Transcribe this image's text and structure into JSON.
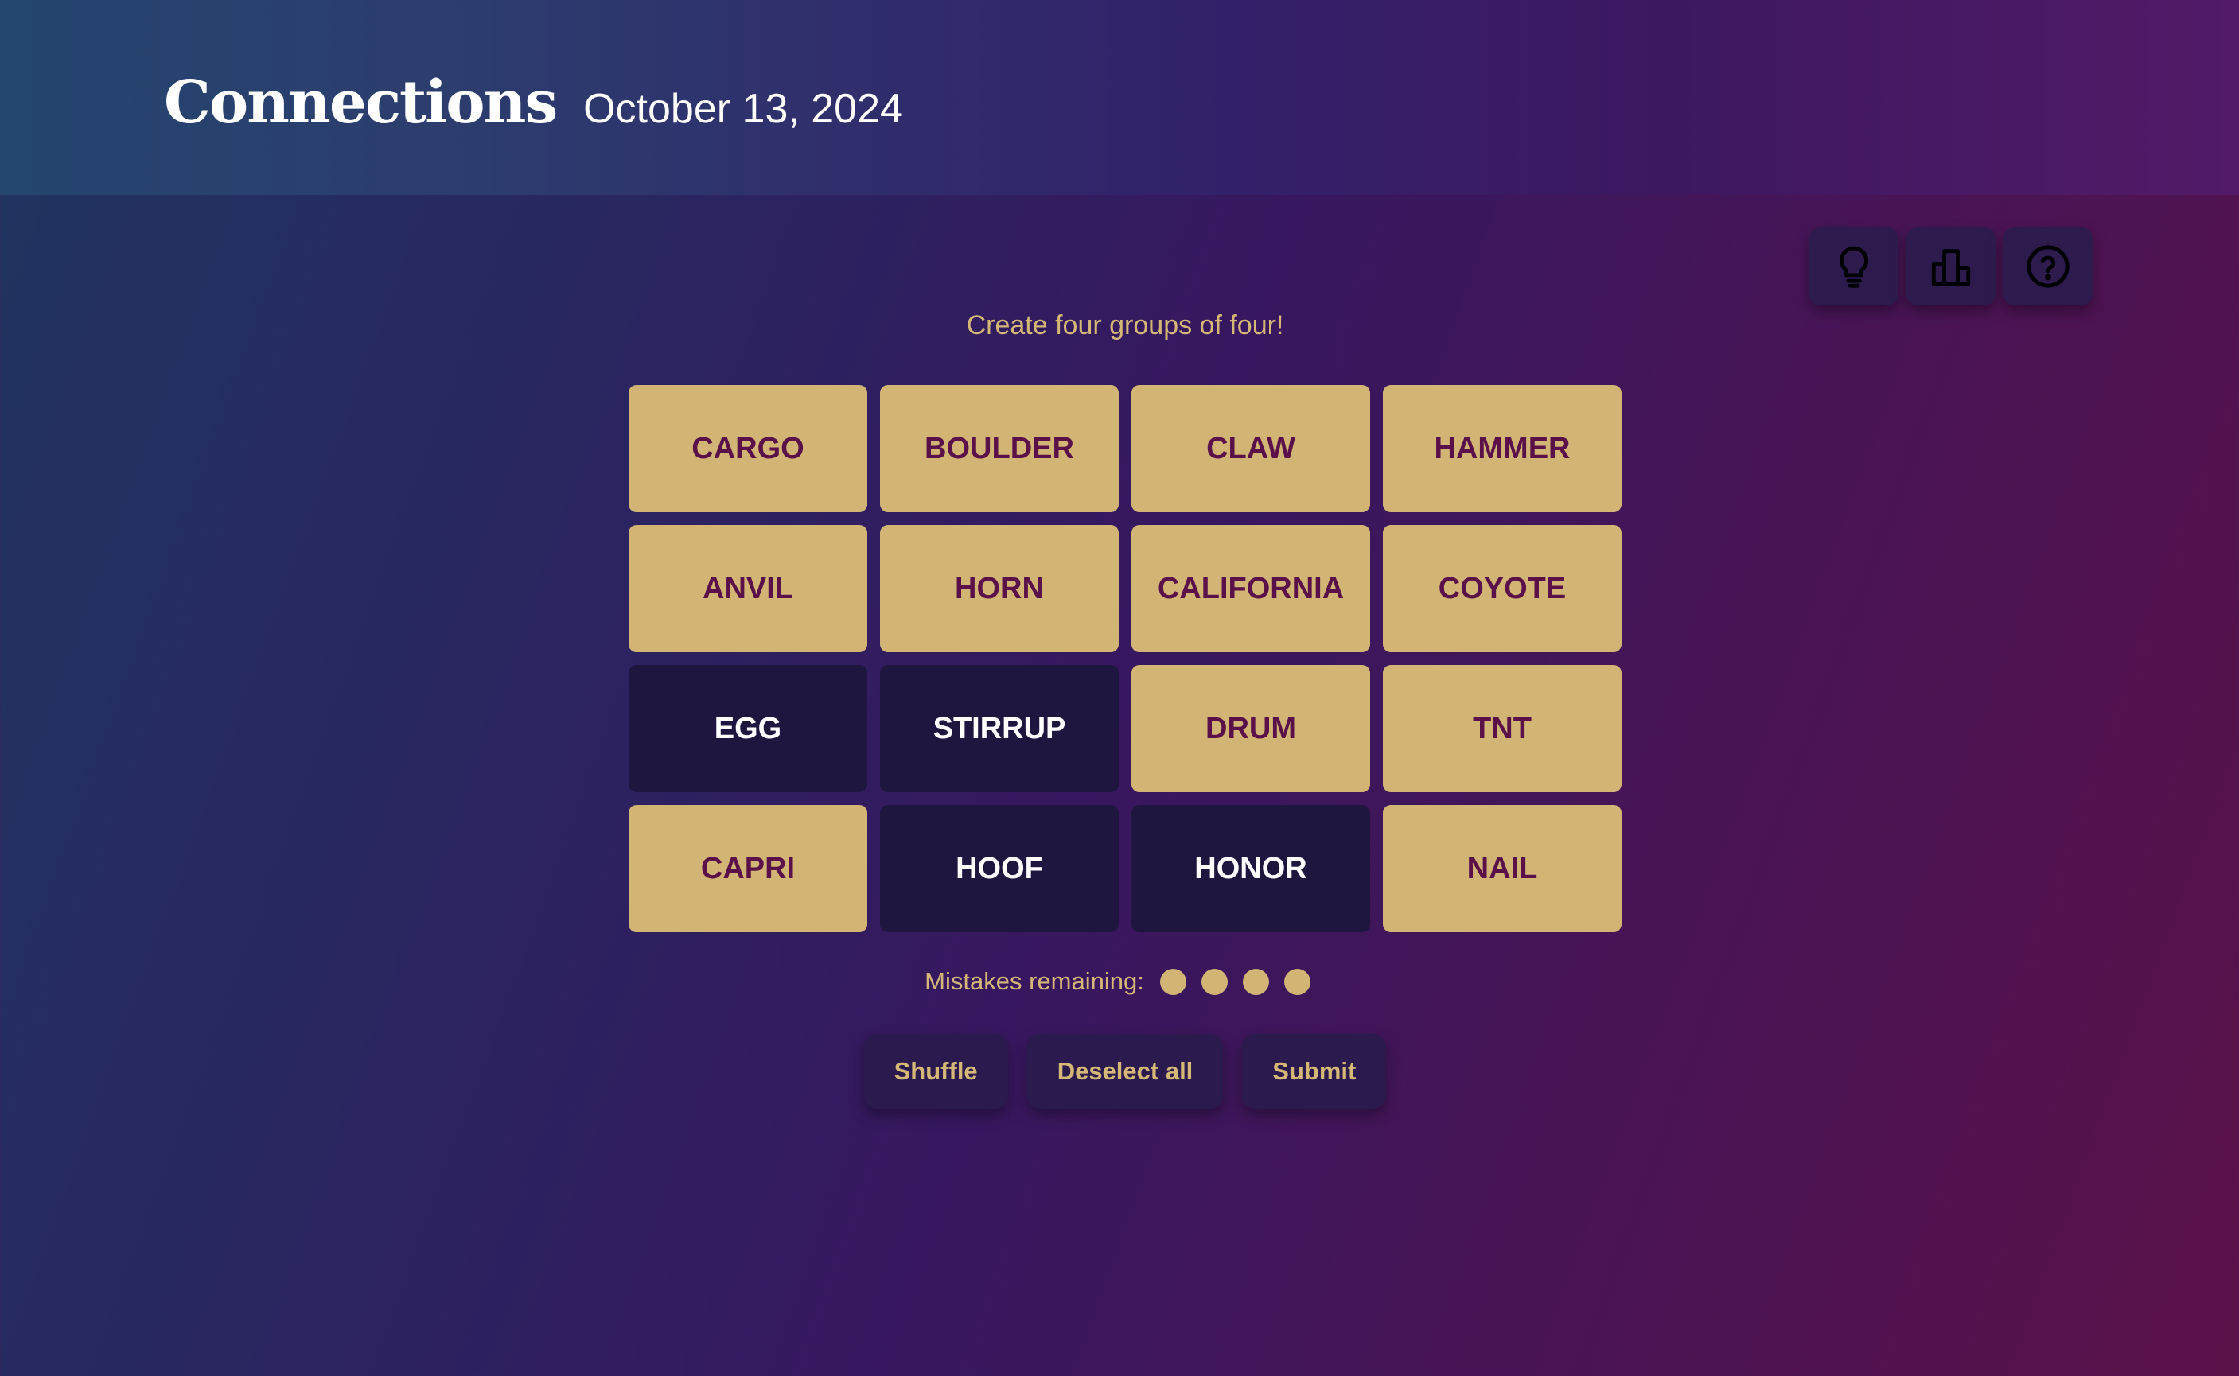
{
  "header": {
    "title": "Connections",
    "date": "October 13, 2024"
  },
  "toolbar": {
    "icons": [
      "lightbulb-icon",
      "leaderboard-icon",
      "help-icon"
    ]
  },
  "prompt": "Create four groups of four!",
  "tiles": [
    {
      "label": "CARGO",
      "selected": false
    },
    {
      "label": "BOULDER",
      "selected": false
    },
    {
      "label": "CLAW",
      "selected": false
    },
    {
      "label": "HAMMER",
      "selected": false
    },
    {
      "label": "ANVIL",
      "selected": false
    },
    {
      "label": "HORN",
      "selected": false
    },
    {
      "label": "CALIFORNIA",
      "selected": false
    },
    {
      "label": "COYOTE",
      "selected": false
    },
    {
      "label": "EGG",
      "selected": true
    },
    {
      "label": "STIRRUP",
      "selected": true
    },
    {
      "label": "DRUM",
      "selected": false
    },
    {
      "label": "TNT",
      "selected": false
    },
    {
      "label": "CAPRI",
      "selected": false
    },
    {
      "label": "HOOF",
      "selected": true
    },
    {
      "label": "HONOR",
      "selected": true
    },
    {
      "label": "NAIL",
      "selected": false
    }
  ],
  "mistakes": {
    "label": "Mistakes remaining:",
    "remaining": 4
  },
  "actions": {
    "shuffle": "Shuffle",
    "deselect_all": "Deselect all",
    "submit": "Submit"
  },
  "colors": {
    "tile_unselected_bg": "#d2b574",
    "tile_unselected_text": "#5a1048",
    "tile_selected_bg": "#1f1640",
    "tile_selected_text": "#ffffff",
    "accent_text": "#d6b876"
  }
}
